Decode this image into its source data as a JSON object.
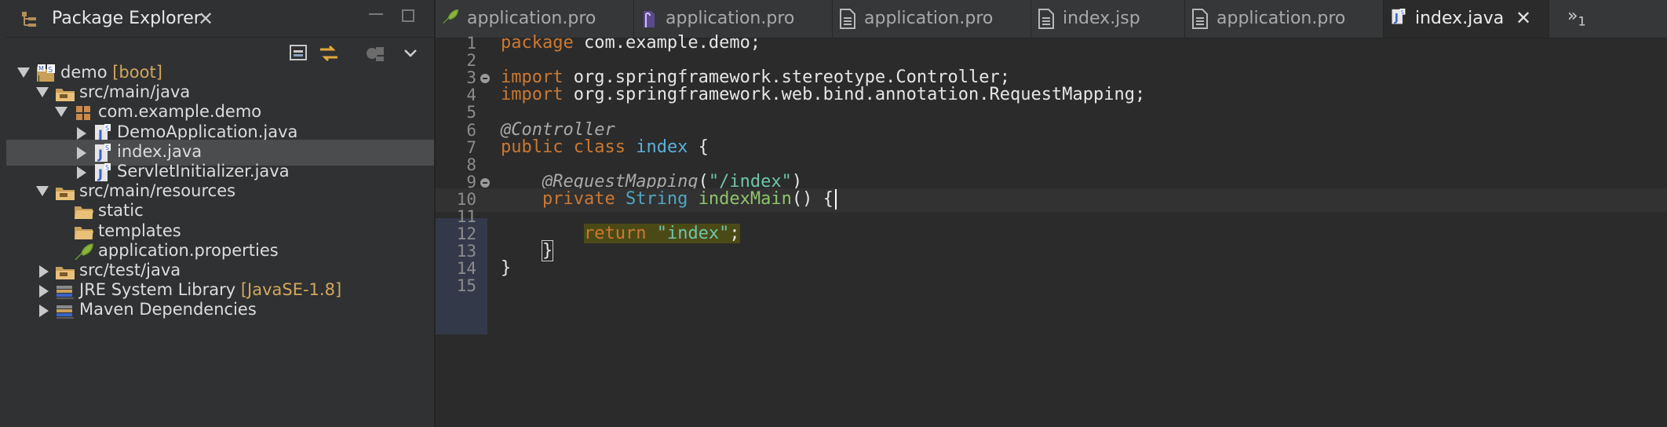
{
  "explorer": {
    "title": "Package Explorer",
    "tree": [
      {
        "label": "demo",
        "decoration": " [boot]",
        "depth": 0,
        "expanded": true,
        "icon": "project-icon"
      },
      {
        "label": "src/main/java",
        "decoration": "",
        "depth": 1,
        "expanded": true,
        "icon": "source-folder-icon"
      },
      {
        "label": "com.example.demo",
        "decoration": "",
        "depth": 2,
        "expanded": true,
        "icon": "package-icon"
      },
      {
        "label": "DemoApplication.java",
        "decoration": "",
        "depth": 3,
        "expanded": false,
        "icon": "java-file-icon"
      },
      {
        "label": "index.java",
        "decoration": "",
        "depth": 3,
        "expanded": false,
        "icon": "java-file-icon",
        "selected": true
      },
      {
        "label": "ServletInitializer.java",
        "decoration": "",
        "depth": 3,
        "expanded": false,
        "icon": "java-file-icon"
      },
      {
        "label": "src/main/resources",
        "decoration": "",
        "depth": 1,
        "expanded": true,
        "icon": "source-folder-icon"
      },
      {
        "label": "static",
        "decoration": "",
        "depth": 2,
        "expanded": null,
        "icon": "folder-icon"
      },
      {
        "label": "templates",
        "decoration": "",
        "depth": 2,
        "expanded": null,
        "icon": "folder-icon"
      },
      {
        "label": "application.properties",
        "decoration": "",
        "depth": 2,
        "expanded": null,
        "icon": "properties-file-icon"
      },
      {
        "label": "src/test/java",
        "decoration": "",
        "depth": 1,
        "expanded": false,
        "icon": "source-folder-icon"
      },
      {
        "label": "JRE System Library",
        "decoration": " [JavaSE-1.8]",
        "depth": 1,
        "expanded": false,
        "icon": "library-icon"
      },
      {
        "label": "Maven Dependencies",
        "decoration": "",
        "depth": 1,
        "expanded": false,
        "icon": "library-icon"
      }
    ]
  },
  "editor": {
    "tabs": [
      {
        "label": "application.pro",
        "icon": "properties-file-icon",
        "active": false
      },
      {
        "label": "application.pro",
        "icon": "file-icon",
        "active": false
      },
      {
        "label": "application.pro",
        "icon": "text-file-icon",
        "active": false
      },
      {
        "label": "index.jsp",
        "icon": "text-file-icon",
        "active": false
      },
      {
        "label": "application.pro",
        "icon": "text-file-icon",
        "active": false
      },
      {
        "label": "index.java",
        "icon": "java-file-icon",
        "active": true
      }
    ],
    "overflow_label": "»",
    "overflow_count": "1",
    "lines": [
      {
        "n": "1",
        "fold": false,
        "tokens": [
          [
            "kw",
            "package"
          ],
          [
            "t",
            " com.example.demo;"
          ]
        ]
      },
      {
        "n": "2",
        "fold": false,
        "tokens": []
      },
      {
        "n": "3",
        "fold": true,
        "tokens": [
          [
            "kw",
            "import"
          ],
          [
            "t",
            " org.springframework.stereotype.Controller;"
          ]
        ]
      },
      {
        "n": "4",
        "fold": false,
        "tokens": [
          [
            "kw",
            "import"
          ],
          [
            "t",
            " org.springframework.web.bind.annotation.RequestMapping;"
          ]
        ]
      },
      {
        "n": "5",
        "fold": false,
        "tokens": []
      },
      {
        "n": "6",
        "fold": false,
        "tokens": [
          [
            "ann",
            "@Controller"
          ]
        ]
      },
      {
        "n": "7",
        "fold": false,
        "tokens": [
          [
            "kw",
            "public class"
          ],
          [
            "t",
            " "
          ],
          [
            "cls",
            "index"
          ],
          [
            "t",
            " {"
          ]
        ]
      },
      {
        "n": "8",
        "fold": false,
        "tokens": []
      },
      {
        "n": "9",
        "fold": true,
        "tokens": [
          [
            "t",
            "    "
          ],
          [
            "ann",
            "@RequestMapping"
          ],
          [
            "t",
            "("
          ],
          [
            "str",
            "\"/index\""
          ],
          [
            "t",
            ")"
          ]
        ]
      },
      {
        "n": "10",
        "fold": false,
        "current": true,
        "tokens": [
          [
            "t",
            "    "
          ],
          [
            "kw",
            "private"
          ],
          [
            "t",
            " "
          ],
          [
            "typ",
            "String"
          ],
          [
            "t",
            " "
          ],
          [
            "mth",
            "indexMain"
          ],
          [
            "t",
            "() {"
          ],
          [
            "caret",
            ""
          ]
        ]
      },
      {
        "n": "11",
        "fold": false,
        "tokens": []
      },
      {
        "n": "12",
        "fold": false,
        "tokens": [
          [
            "t",
            "        "
          ],
          [
            "rk",
            "return"
          ],
          [
            "rt",
            " "
          ],
          [
            "rs",
            "\"index\""
          ],
          [
            "rt",
            ";"
          ]
        ]
      },
      {
        "n": "13",
        "fold": false,
        "tokens": [
          [
            "t",
            "    "
          ],
          [
            "box",
            "}"
          ]
        ]
      },
      {
        "n": "14",
        "fold": false,
        "tokens": [
          [
            "t",
            "}"
          ]
        ]
      },
      {
        "n": "15",
        "fold": false,
        "tokens": []
      }
    ]
  },
  "colors": {
    "keyword": "#cc7832",
    "string": "#6ec6a8",
    "annotation": "#a9a9a9",
    "class_name": "#5ab0d8",
    "method": "#8fc36b",
    "decoration": "#d2a75b"
  }
}
